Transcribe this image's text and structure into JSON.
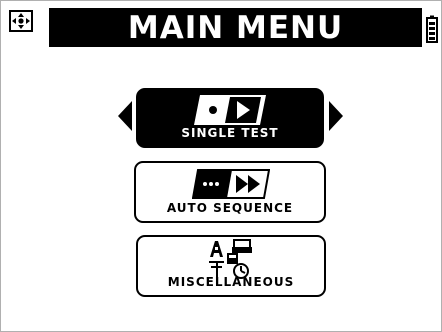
{
  "header": {
    "title": "MAIN MENU"
  },
  "menu": {
    "items": [
      {
        "label": "SINGLE TEST",
        "selected": true,
        "icon": "single-test-icon"
      },
      {
        "label": "AUTO SEQUENCE",
        "selected": false,
        "icon": "auto-sequence-icon"
      },
      {
        "label": "MISCELLANEOUS",
        "selected": false,
        "icon": "miscellaneous-icon"
      }
    ]
  },
  "icons": {
    "top_left": "navigation-cross-icon",
    "top_right": "battery-icon",
    "scroll_left": "arrow-left-icon",
    "scroll_right": "arrow-right-icon"
  },
  "colors": {
    "foreground": "#000000",
    "background": "#ffffff"
  }
}
